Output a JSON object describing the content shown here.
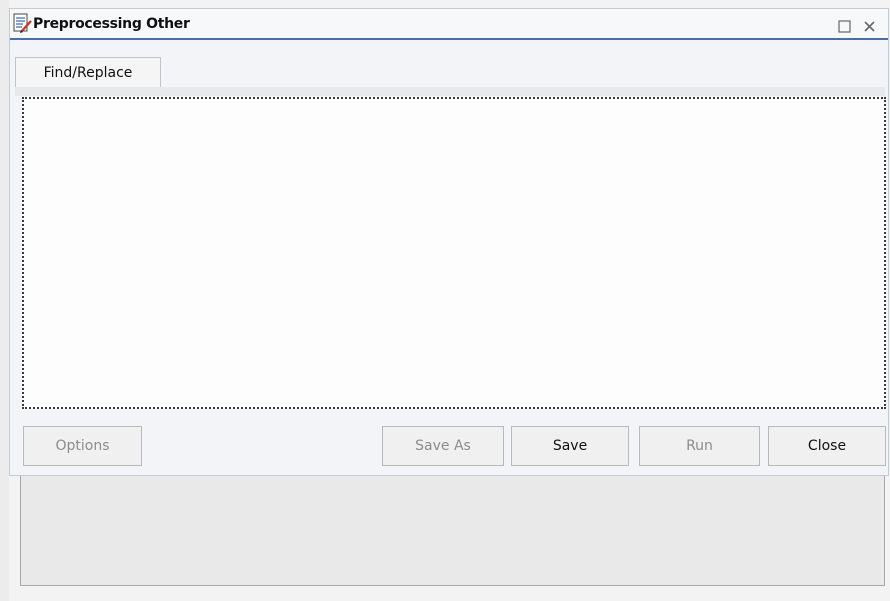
{
  "window": {
    "title": "Preprocessing Other",
    "maximize_icon": "maximize-icon",
    "close_icon": "close-icon"
  },
  "tabs": [
    {
      "label": "Find/Replace",
      "selected": true
    }
  ],
  "editor": {
    "value": ""
  },
  "buttons": {
    "options": {
      "label": "Options",
      "enabled": false
    },
    "save_as": {
      "label": "Save As",
      "enabled": false
    },
    "save": {
      "label": "Save",
      "enabled": true
    },
    "run": {
      "label": "Run",
      "enabled": false
    },
    "close": {
      "label": "Close",
      "enabled": true
    }
  },
  "colors": {
    "title_accent": "#4a6ea9",
    "disabled_text": "#8c8c8c"
  }
}
